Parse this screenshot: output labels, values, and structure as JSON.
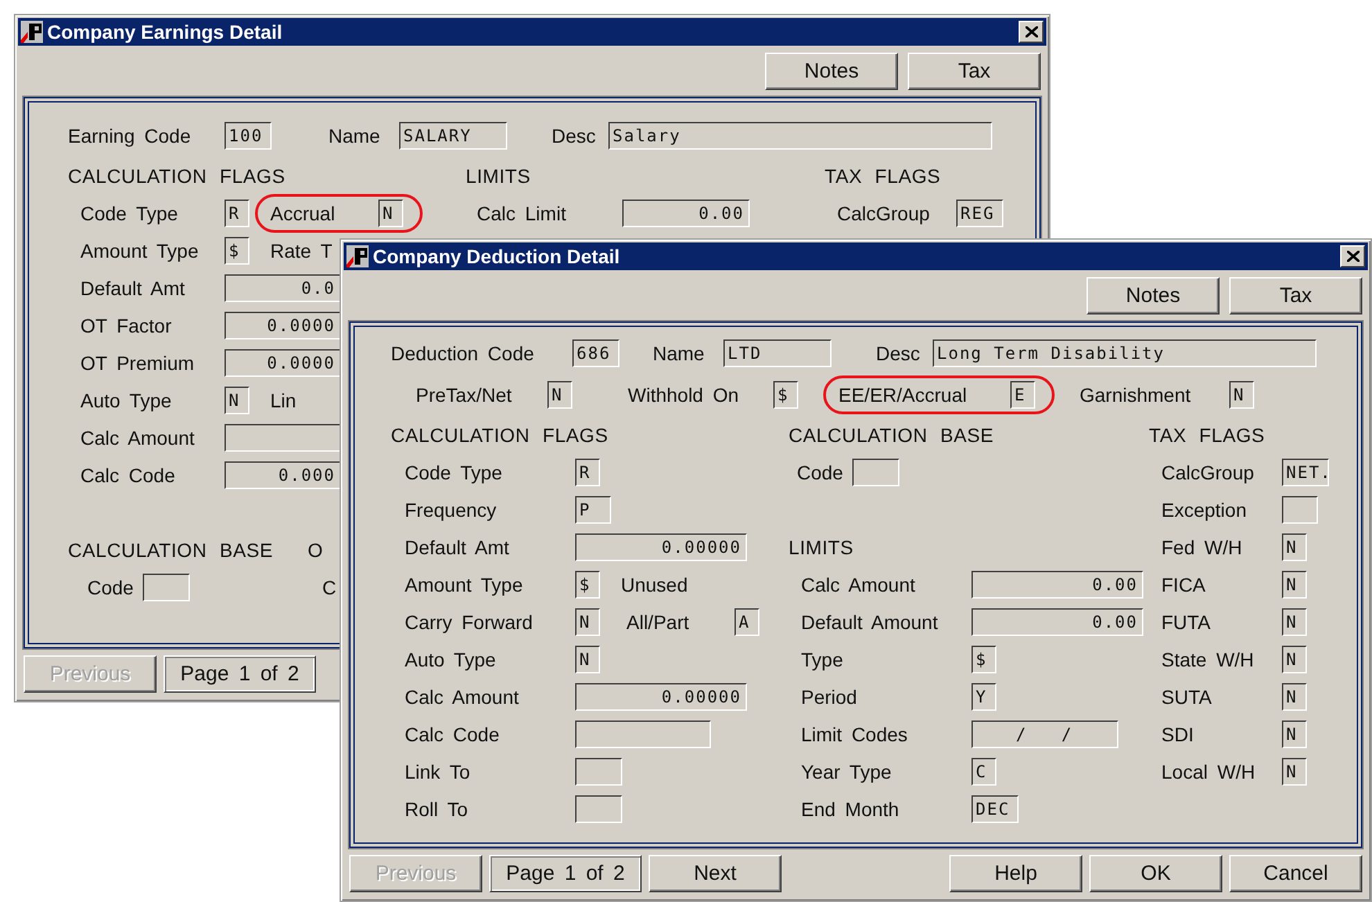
{
  "windows": [
    {
      "title": "Company Earnings Detail",
      "top_buttons": [
        "Notes",
        "Tax"
      ],
      "header_rows": [
        [
          {
            "label": "Earning Code",
            "value": "100",
            "kind": "code"
          },
          {
            "label": "Name",
            "value": "SALARY",
            "kind": "name"
          },
          {
            "label": "Desc",
            "value": "Salary",
            "kind": "desc"
          }
        ]
      ],
      "columns": [
        {
          "items": [
            {
              "kind": "heading",
              "text": "CALCULATION FLAGS"
            },
            {
              "kind": "flag",
              "label": "Code Type",
              "value": "R",
              "pair": {
                "label": "Accrual",
                "value": "N",
                "highlighted": true
              }
            },
            {
              "kind": "flag",
              "label": "Amount Type",
              "value": "$",
              "note": "Rate T"
            },
            {
              "kind": "partial",
              "label": "Default Amt",
              "value": "0.0"
            },
            {
              "kind": "partial",
              "label": "OT Factor",
              "value": "0.0000"
            },
            {
              "kind": "partial",
              "label": "OT Premium",
              "value": "0.0000"
            },
            {
              "kind": "flag",
              "label": "Auto Type",
              "value": "N",
              "note": "Lin"
            },
            {
              "kind": "partial",
              "label": "Calc Amount"
            },
            {
              "kind": "partial",
              "label": "Calc Code",
              "value": "0.000"
            },
            {
              "kind": "gap"
            },
            {
              "kind": "heading",
              "text": "CALCULATION BASE",
              "note": "O"
            },
            {
              "kind": "basecode",
              "label": "Code",
              "note": "C"
            }
          ]
        },
        {
          "items": [
            {
              "kind": "heading",
              "text": "LIMITS"
            },
            {
              "kind": "money",
              "label": "Calc Limit",
              "value": "0.00"
            }
          ]
        },
        {
          "items": [
            {
              "kind": "heading",
              "text": "TAX FLAGS"
            },
            {
              "kind": "code",
              "label": "CalcGroup",
              "value": "REG"
            }
          ]
        }
      ],
      "bottom_buttons": [
        {
          "label": "Previous",
          "disabled": true,
          "kind": "button"
        },
        {
          "label": "Page 1 of 2",
          "kind": "indicator"
        }
      ]
    },
    {
      "title": "Company Deduction Detail",
      "top_buttons": [
        "Notes",
        "Tax"
      ],
      "header_rows": [
        [
          {
            "label": "Deduction Code",
            "value": "686",
            "kind": "code"
          },
          {
            "label": "Name",
            "value": "LTD",
            "kind": "name"
          },
          {
            "label": "Desc",
            "value": "Long Term Disability",
            "kind": "desc"
          }
        ],
        [
          {
            "label": "PreTax/Net",
            "value": "N",
            "kind": "flag"
          },
          {
            "label": "Withhold On",
            "value": "$",
            "kind": "flag"
          },
          {
            "label": "EE/ER/Accrual",
            "value": "E",
            "kind": "flag",
            "highlighted": true
          },
          {
            "label": "Garnishment",
            "value": "N",
            "kind": "flag"
          }
        ]
      ],
      "columns": [
        {
          "items": [
            {
              "kind": "heading",
              "text": "CALCULATION FLAGS"
            },
            {
              "kind": "flag",
              "label": "Code Type",
              "value": "R"
            },
            {
              "kind": "wideflag",
              "label": "Frequency",
              "value": "P"
            },
            {
              "kind": "amount",
              "label": "Default Amt",
              "value": "0.00000"
            },
            {
              "kind": "flag",
              "label": "Amount Type",
              "value": "$",
              "note": "Unused"
            },
            {
              "kind": "flag",
              "label": "Carry Forward",
              "value": "N",
              "pair": {
                "label": "All/Part",
                "value": "A",
                "highlighted": false
              }
            },
            {
              "kind": "flag",
              "label": "Auto Type",
              "value": "N"
            },
            {
              "kind": "amount",
              "label": "Calc Amount",
              "value": "0.00000"
            },
            {
              "kind": "memo",
              "label": "Calc Code"
            },
            {
              "kind": "code",
              "label": "Link To"
            },
            {
              "kind": "code",
              "label": "Roll To"
            }
          ]
        },
        {
          "items": [
            {
              "kind": "heading",
              "text": "CALCULATION BASE"
            },
            {
              "kind": "basecode",
              "label": "Code"
            },
            {
              "kind": "gap"
            },
            {
              "kind": "heading",
              "text": "LIMITS"
            },
            {
              "kind": "amount",
              "label": "Calc Amount",
              "value": "0.00"
            },
            {
              "kind": "amount",
              "label": "Default Amount",
              "value": "0.00"
            },
            {
              "kind": "flag",
              "label": "Type",
              "value": "$"
            },
            {
              "kind": "flag",
              "label": "Period",
              "value": "Y"
            },
            {
              "kind": "range",
              "label": "Limit Codes",
              "value": "/   /"
            },
            {
              "kind": "flag",
              "label": "Year Type",
              "value": "C"
            },
            {
              "kind": "code",
              "label": "End Month",
              "value": "DEC"
            }
          ]
        },
        {
          "items": [
            {
              "kind": "heading",
              "text": "TAX FLAGS"
            },
            {
              "kind": "code",
              "label": "CalcGroup",
              "value": "NET."
            },
            {
              "kind": "wideflag",
              "label": "Exception"
            },
            {
              "kind": "flag",
              "label": "Fed W/H",
              "value": "N"
            },
            {
              "kind": "flag",
              "label": "FICA",
              "value": "N"
            },
            {
              "kind": "flag",
              "label": "FUTA",
              "value": "N"
            },
            {
              "kind": "flag",
              "label": "State W/H",
              "value": "N"
            },
            {
              "kind": "flag",
              "label": "SUTA",
              "value": "N"
            },
            {
              "kind": "flag",
              "label": "SDI",
              "value": "N"
            },
            {
              "kind": "flag",
              "label": "Local W/H",
              "value": "N"
            }
          ]
        }
      ],
      "bottom_buttons": [
        {
          "label": "Previous",
          "disabled": true,
          "kind": "button"
        },
        {
          "label": "Page 1 of 2",
          "kind": "indicator"
        },
        {
          "label": "Next",
          "disabled": false,
          "kind": "button"
        },
        {
          "kind": "spacer"
        },
        {
          "label": "Help",
          "disabled": false,
          "kind": "button"
        },
        {
          "label": "OK",
          "disabled": false,
          "kind": "button"
        },
        {
          "label": "Cancel",
          "disabled": false,
          "kind": "button"
        }
      ]
    }
  ]
}
